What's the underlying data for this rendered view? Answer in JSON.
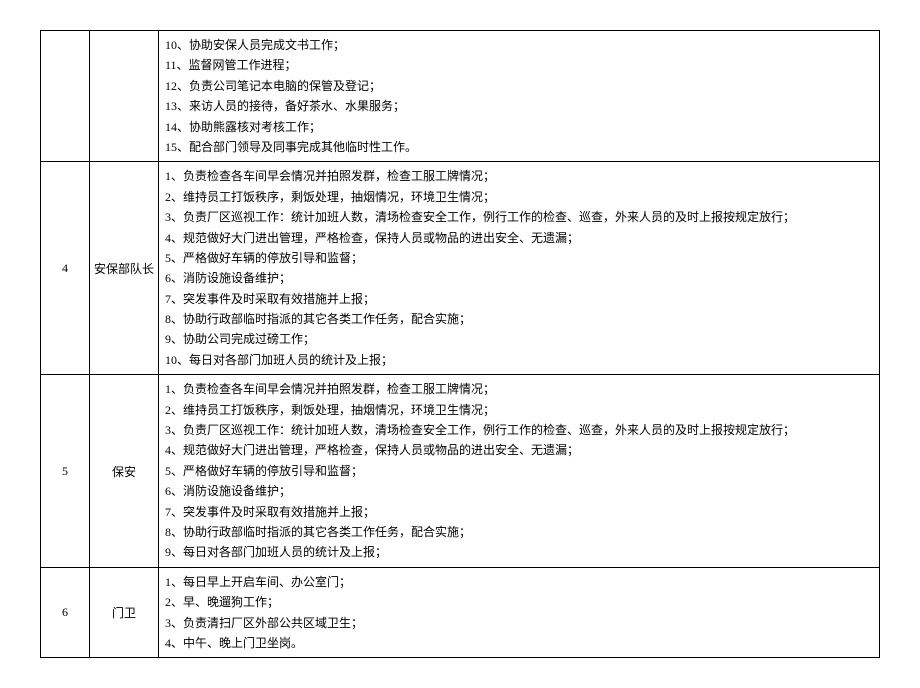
{
  "rows": [
    {
      "num": "",
      "role": "",
      "duties": [
        "10、协助安保人员完成文书工作；",
        "11、监督网管工作进程；",
        "12、负责公司笔记本电脑的保管及登记；",
        "13、来访人员的接待，备好茶水、水果服务；",
        "14、协助熊露核对考核工作；",
        "15、配合部门领导及同事完成其他临时性工作。"
      ]
    },
    {
      "num": "4",
      "role": "安保部队长",
      "duties": [
        "1、负责检查各车间早会情况并拍照发群，检查工服工牌情况；",
        "2、维持员工打饭秩序，剩饭处理，抽烟情况，环境卫生情况；",
        "3、负责厂区巡视工作：统计加班人数，清场检查安全工作，例行工作的检查、巡查，外来人员的及时上报按规定放行；",
        "4、规范做好大门进出管理，严格检查，保持人员或物品的进出安全、无遗漏；",
        "5、严格做好车辆的停放引导和监督；",
        "6、消防设施设备维护；",
        "7、突发事件及时采取有效措施并上报；",
        "8、协助行政部临时指派的其它各类工作任务，配合实施；",
        "9、协助公司完成过磅工作；",
        "10、每日对各部门加班人员的统计及上报；"
      ]
    },
    {
      "num": "5",
      "role": "保安",
      "duties": [
        "1、负责检查各车间早会情况并拍照发群，检查工服工牌情况；",
        "2、维持员工打饭秩序，剩饭处理，抽烟情况，环境卫生情况；",
        "3、负责厂区巡视工作：统计加班人数，清场检查安全工作，例行工作的检查、巡查，外来人员的及时上报按规定放行；",
        "4、规范做好大门进出管理，严格检查，保持人员或物品的进出安全、无遗漏；",
        "5、严格做好车辆的停放引导和监督；",
        "6、消防设施设备维护；",
        "7、突发事件及时采取有效措施并上报；",
        "8、协助行政部临时指派的其它各类工作任务，配合实施；",
        "9、每日对各部门加班人员的统计及上报；"
      ]
    },
    {
      "num": "6",
      "role": "门卫",
      "duties": [
        "1、每日早上开启车间、办公室门；",
        "2、早、晚遛狗工作；",
        "3、负责清扫厂区外部公共区域卫生；",
        "4、中午、晚上门卫坐岗。"
      ]
    }
  ]
}
